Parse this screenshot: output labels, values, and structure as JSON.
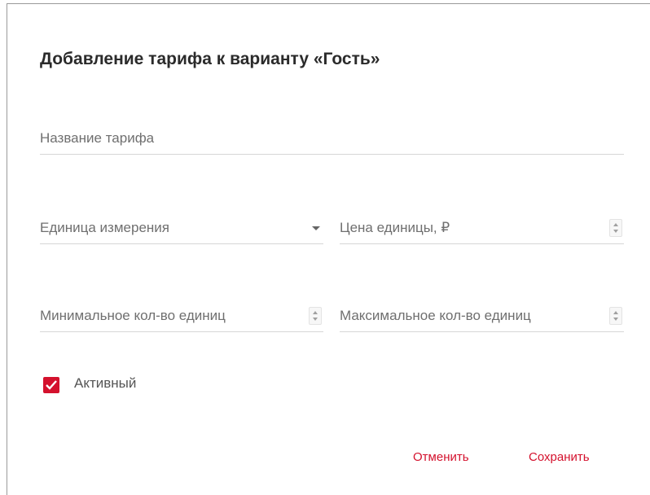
{
  "dialog": {
    "title": "Добавление тарифа к варианту «Гость»",
    "fields": {
      "tariff_name": {
        "placeholder": "Название тарифа",
        "value": ""
      },
      "unit": {
        "label": "Единица измерения",
        "value": ""
      },
      "unit_price": {
        "placeholder": "Цена единицы, ₽",
        "value": ""
      },
      "min_units": {
        "placeholder": "Минимальное кол-во единиц",
        "value": ""
      },
      "max_units": {
        "placeholder": "Максимальное кол-во единиц",
        "value": ""
      }
    },
    "active_checkbox": {
      "label": "Активный",
      "checked": true
    },
    "buttons": {
      "cancel": "Отменить",
      "save": "Сохранить"
    }
  },
  "colors": {
    "accent": "#d4112d",
    "text_muted": "#6f6f6f",
    "divider": "#d6d6d6"
  }
}
